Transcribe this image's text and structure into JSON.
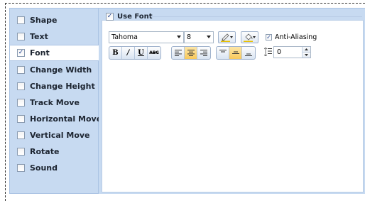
{
  "sidebar": {
    "items": [
      {
        "label": "Shape",
        "checked": false,
        "selected": false
      },
      {
        "label": "Text",
        "checked": false,
        "selected": false
      },
      {
        "label": "Font",
        "checked": true,
        "selected": true
      },
      {
        "label": "Change Width",
        "checked": false,
        "selected": false
      },
      {
        "label": "Change Height",
        "checked": false,
        "selected": false
      },
      {
        "label": "Track Move",
        "checked": false,
        "selected": false
      },
      {
        "label": "Horizontal Move",
        "checked": false,
        "selected": false
      },
      {
        "label": "Vertical Move",
        "checked": false,
        "selected": false
      },
      {
        "label": "Rotate",
        "checked": false,
        "selected": false
      },
      {
        "label": "Sound",
        "checked": false,
        "selected": false
      }
    ]
  },
  "panel": {
    "use_font_label": "Use Font",
    "use_font_checked": true,
    "font_name": "Tahoma",
    "font_size": "8",
    "anti_aliasing_label": "Anti-Aliasing",
    "anti_aliasing_checked": true,
    "format_buttons": {
      "bold": "B",
      "italic": "I",
      "underline": "U",
      "strikeout": "ABC"
    },
    "horizontal_alignment": "center",
    "vertical_alignment": "middle",
    "line_spacing": "0"
  },
  "colors": {
    "sidebar_bg": "#c7daf1",
    "active_button": "#f8c85a",
    "pen_color": "#e8c000",
    "fill_color": "#e8c000"
  }
}
